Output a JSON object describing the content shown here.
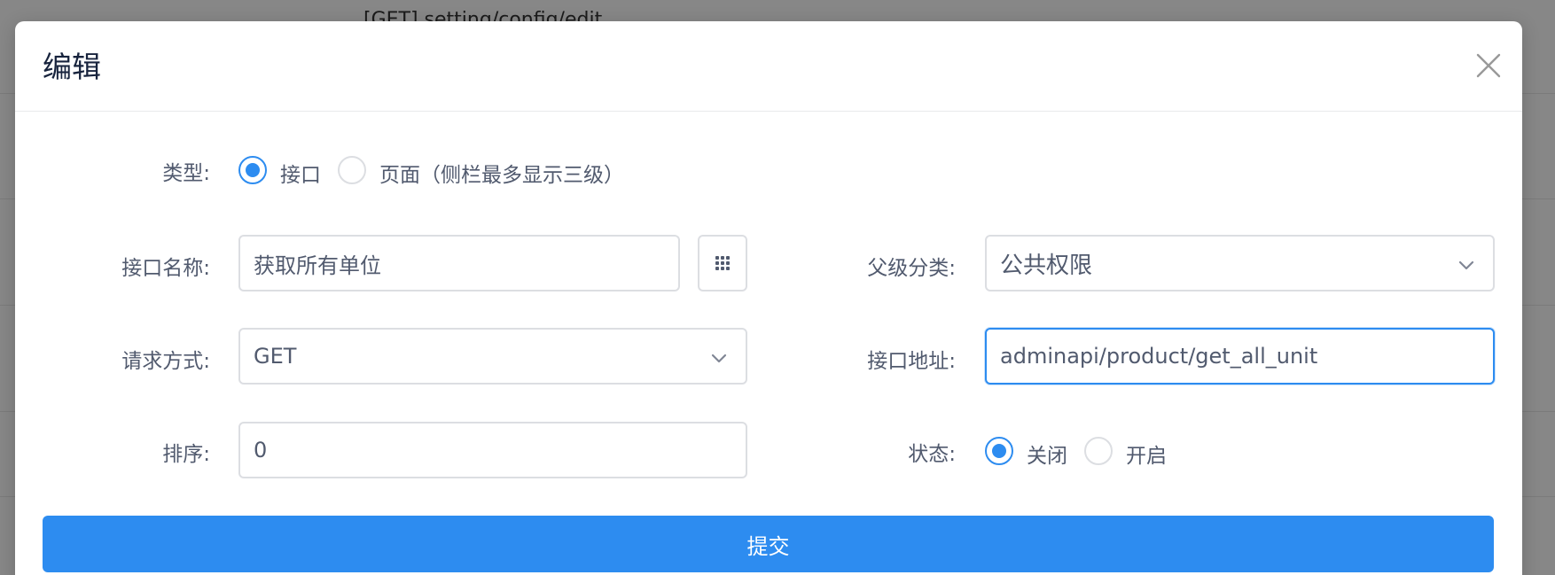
{
  "background": {
    "route_text": "[GET] setting/config/edit"
  },
  "modal": {
    "title": "编辑",
    "close_icon": "close-icon"
  },
  "form": {
    "type": {
      "label": "类型:",
      "options": [
        {
          "label": "接口",
          "checked": true
        },
        {
          "label": "页面（侧栏最多显示三级）",
          "checked": false
        }
      ]
    },
    "api_name": {
      "label": "接口名称:",
      "value": "获取所有单位",
      "icon": "grid-icon"
    },
    "parent_category": {
      "label": "父级分类:",
      "value": "公共权限"
    },
    "request_method": {
      "label": "请求方式:",
      "value": "GET"
    },
    "api_path": {
      "label": "接口地址:",
      "value": "adminapi/product/get_all_unit"
    },
    "sort": {
      "label": "排序:",
      "value": "0"
    },
    "status": {
      "label": "状态:",
      "options": [
        {
          "label": "关闭",
          "checked": true
        },
        {
          "label": "开启",
          "checked": false
        }
      ]
    },
    "submit_label": "提交"
  },
  "colors": {
    "primary": "#2d8cf0",
    "border": "#dcdee2",
    "text": "#515a6e",
    "title": "#17233d"
  }
}
